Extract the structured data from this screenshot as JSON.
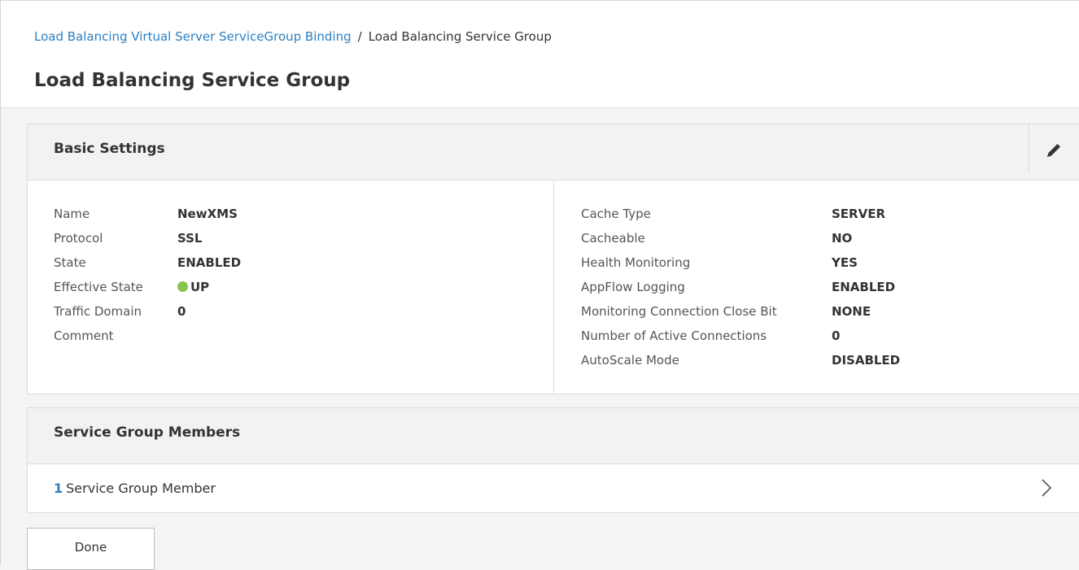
{
  "breadcrumb": {
    "parent": "Load Balancing Virtual Server ServiceGroup Binding",
    "separator": "/",
    "current": "Load Balancing Service Group"
  },
  "page": {
    "title": "Load Balancing Service Group"
  },
  "basic_settings": {
    "title": "Basic Settings",
    "edit_icon": "pencil-icon",
    "left": [
      {
        "label": "Name",
        "value": "NewXMS"
      },
      {
        "label": "Protocol",
        "value": "SSL"
      },
      {
        "label": "State",
        "value": "ENABLED"
      },
      {
        "label": "Effective State",
        "value": "UP",
        "status_color": "#8bc34a"
      },
      {
        "label": "Traffic Domain",
        "value": "0"
      },
      {
        "label": "Comment",
        "value": ""
      }
    ],
    "right": [
      {
        "label": "Cache Type",
        "value": "SERVER"
      },
      {
        "label": "Cacheable",
        "value": "NO"
      },
      {
        "label": "Health Monitoring",
        "value": "YES"
      },
      {
        "label": "AppFlow Logging",
        "value": "ENABLED"
      },
      {
        "label": "Monitoring Connection Close Bit",
        "value": "NONE"
      },
      {
        "label": "Number of Active Connections",
        "value": "0"
      },
      {
        "label": "AutoScale Mode",
        "value": "DISABLED"
      }
    ]
  },
  "members": {
    "title": "Service Group Members",
    "count": "1",
    "label": "Service Group Member",
    "chevron_icon": "chevron-right-icon"
  },
  "footer": {
    "done_label": "Done"
  },
  "colors": {
    "link": "#2a7fc1",
    "panel_header_bg": "#f2f2f2",
    "page_bg": "#f4f4f4",
    "status_up": "#8bc34a"
  }
}
